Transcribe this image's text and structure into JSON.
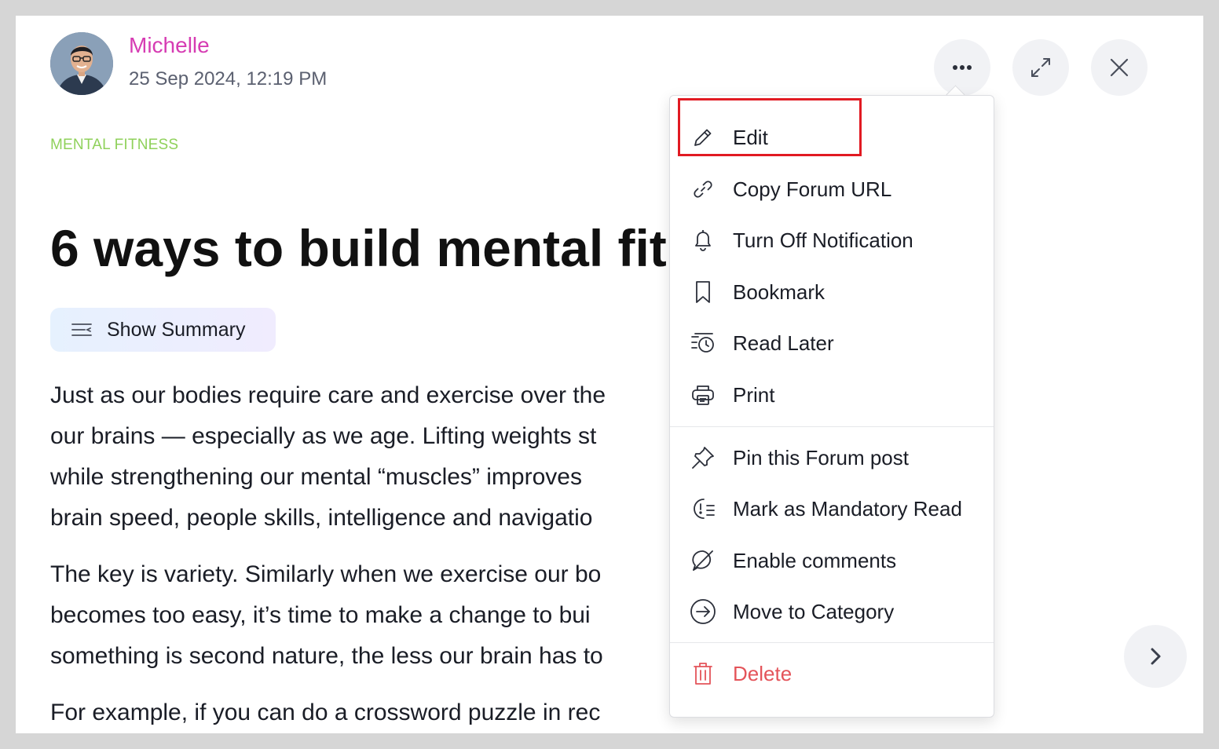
{
  "post": {
    "author": "Michelle",
    "date": "25 Sep 2024, 12:19 PM",
    "category": "MENTAL FITNESS",
    "title": "6 ways to build mental fit",
    "summary_label": "Show Summary",
    "paragraphs": [
      [
        "Just as our bodies require care and exercise over the",
        "our brains — especially as we age. Lifting weights st",
        "while strengthening our mental “muscles” improves",
        "brain speed, people skills, intelligence and navigatio"
      ],
      [
        "The key is variety. Similarly when we exercise our bo",
        "becomes too easy, it’s time to make a change to bui",
        "something is second nature, the less our brain has to"
      ],
      [
        "For example, if you can do a crossword puzzle in rec"
      ]
    ]
  },
  "menu": {
    "items": [
      {
        "label": "Edit",
        "icon": "pencil-icon"
      },
      {
        "label": "Copy Forum URL",
        "icon": "link-icon"
      },
      {
        "label": "Turn Off Notification",
        "icon": "bell-icon"
      },
      {
        "label": "Bookmark",
        "icon": "bookmark-icon"
      },
      {
        "label": "Read Later",
        "icon": "read-later-clock-icon"
      },
      {
        "label": "Print",
        "icon": "printer-icon"
      },
      {
        "label": "Pin this Forum post",
        "icon": "pin-icon"
      },
      {
        "label": "Mark as Mandatory Read",
        "icon": "mandatory-read-icon"
      },
      {
        "label": "Enable comments",
        "icon": "comment-disabled-icon"
      },
      {
        "label": "Move to Category",
        "icon": "arrow-circle-right-icon"
      },
      {
        "label": "Delete",
        "icon": "trash-icon"
      }
    ]
  },
  "colors": {
    "author": "#d63cb3",
    "category": "#8fd15b",
    "delete": "#e4545a",
    "highlight": "#e11a22"
  }
}
